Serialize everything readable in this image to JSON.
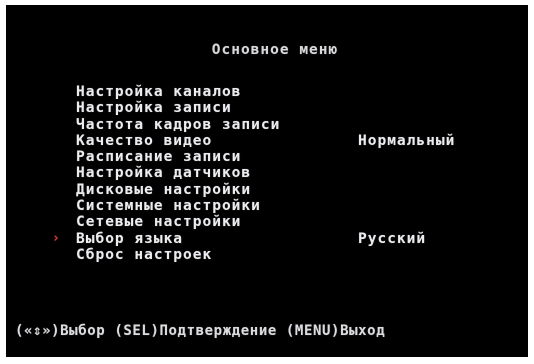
{
  "menu": {
    "title": "Основное меню",
    "items": [
      {
        "label": "Настройка каналов",
        "value": ""
      },
      {
        "label": "Настройка записи",
        "value": ""
      },
      {
        "label": "Частота кадров записи",
        "value": ""
      },
      {
        "label": "Качество видео",
        "value": "Нормальный"
      },
      {
        "label": "Расписание записи",
        "value": ""
      },
      {
        "label": "Настройка датчиков",
        "value": ""
      },
      {
        "label": "Дисковые настройки",
        "value": ""
      },
      {
        "label": "Системные настройки",
        "value": ""
      },
      {
        "label": "Сетевые настройки",
        "value": ""
      },
      {
        "label": "Выбор языка",
        "value": "Русский"
      },
      {
        "label": "Сброс настроек",
        "value": ""
      }
    ],
    "selected_index": 9,
    "selector_glyph": "›",
    "selector_icon": "chevron-right-icon"
  },
  "footer": {
    "select_key": "(«⇕»)",
    "select_label": "Выбор",
    "confirm_key": "(SEL)",
    "confirm_label": "Подтверждение",
    "exit_key": "(MENU)",
    "exit_label": "Выход"
  },
  "colors": {
    "background": "#000000",
    "text": "#ececf0",
    "selector": "#e0302a"
  }
}
